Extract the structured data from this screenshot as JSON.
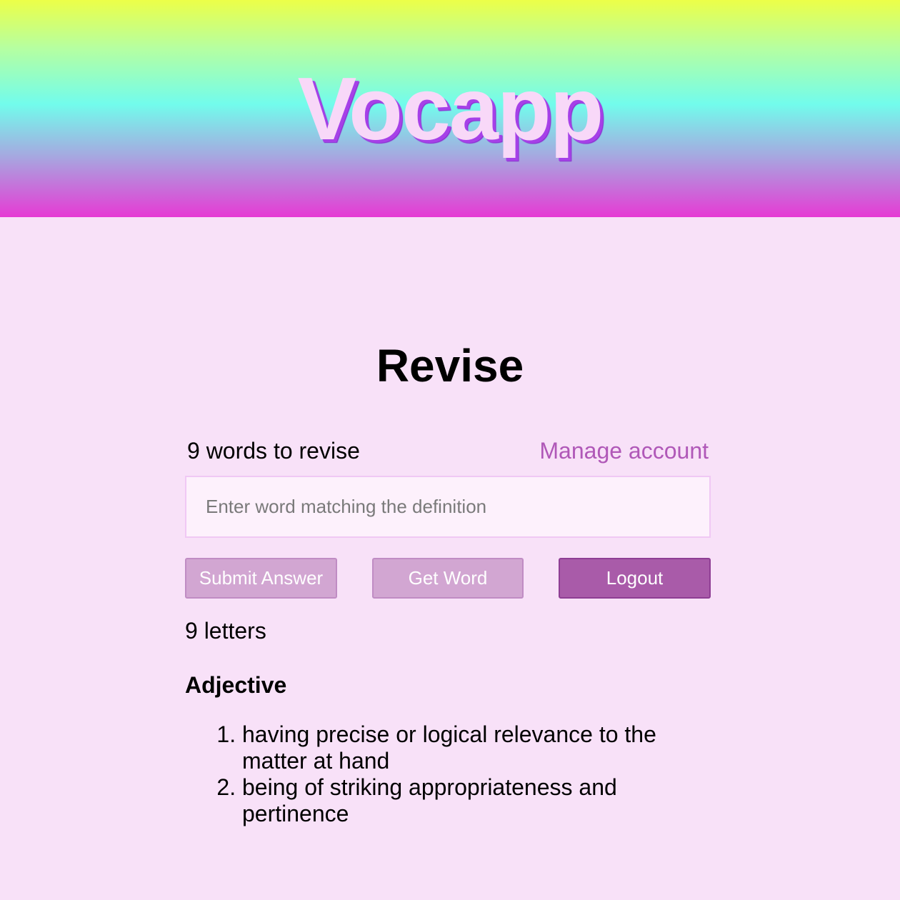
{
  "header": {
    "app_title": "Vocapp"
  },
  "main": {
    "page_title": "Revise",
    "words_to_revise": "9 words to revise",
    "manage_account_label": "Manage account",
    "answer_input": {
      "value": "",
      "placeholder": "Enter word matching the definition"
    },
    "buttons": {
      "submit_label": "Submit Answer",
      "get_word_label": "Get Word",
      "logout_label": "Logout"
    },
    "letter_hint": "9 letters",
    "part_of_speech": "Adjective",
    "definitions": [
      "having precise or logical relevance to the matter at hand",
      "being of striking appropriateness and pertinence"
    ]
  },
  "colors": {
    "background": "#f8e1f8",
    "link": "#b058b8",
    "button_disabled": "#d2a6d2",
    "button_primary": "#a95ba9",
    "logo_text": "#f8d8f8",
    "logo_shadow": "#a640e8"
  }
}
